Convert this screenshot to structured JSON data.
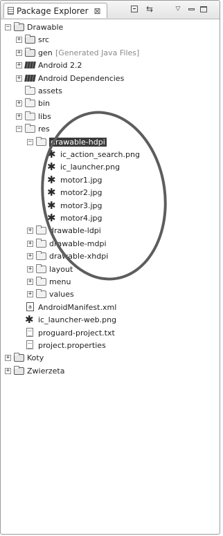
{
  "tab": {
    "title": "Package Explorer",
    "close": "⊠"
  },
  "tree": [
    {
      "label": "Drawable",
      "decor": "",
      "indent": 0,
      "expander": "−",
      "icon": "project"
    },
    {
      "label": "src",
      "decor": "",
      "indent": 1,
      "expander": "+",
      "icon": "pkgfolder"
    },
    {
      "label": "gen",
      "decor": "[Generated Java Files]",
      "indent": 1,
      "expander": "+",
      "icon": "pkgfolder"
    },
    {
      "label": "Android 2.2",
      "decor": "",
      "indent": 1,
      "expander": "+",
      "icon": "library"
    },
    {
      "label": "Android Dependencies",
      "decor": "",
      "indent": 1,
      "expander": "+",
      "icon": "library"
    },
    {
      "label": "assets",
      "decor": "",
      "indent": 1,
      "expander": "",
      "icon": "folder"
    },
    {
      "label": "bin",
      "decor": "",
      "indent": 1,
      "expander": "+",
      "icon": "folder"
    },
    {
      "label": "libs",
      "decor": "",
      "indent": 1,
      "expander": "+",
      "icon": "folder"
    },
    {
      "label": "res",
      "decor": "",
      "indent": 1,
      "expander": "−",
      "icon": "folder"
    },
    {
      "label": "drawable-hdpi",
      "decor": "",
      "indent": 2,
      "expander": "−",
      "icon": "folder",
      "selected": true
    },
    {
      "label": "ic_action_search.png",
      "decor": "",
      "indent": 3,
      "expander": "",
      "icon": "image"
    },
    {
      "label": "ic_launcher.png",
      "decor": "",
      "indent": 3,
      "expander": "",
      "icon": "image"
    },
    {
      "label": "motor1.jpg",
      "decor": "",
      "indent": 3,
      "expander": "",
      "icon": "image"
    },
    {
      "label": "motor2.jpg",
      "decor": "",
      "indent": 3,
      "expander": "",
      "icon": "image"
    },
    {
      "label": "motor3.jpg",
      "decor": "",
      "indent": 3,
      "expander": "",
      "icon": "image"
    },
    {
      "label": "motor4.jpg",
      "decor": "",
      "indent": 3,
      "expander": "",
      "icon": "image"
    },
    {
      "label": "drawable-ldpi",
      "decor": "",
      "indent": 2,
      "expander": "+",
      "icon": "folder"
    },
    {
      "label": "drawable-mdpi",
      "decor": "",
      "indent": 2,
      "expander": "+",
      "icon": "folder"
    },
    {
      "label": "drawable-xhdpi",
      "decor": "",
      "indent": 2,
      "expander": "+",
      "icon": "folder"
    },
    {
      "label": "layout",
      "decor": "",
      "indent": 2,
      "expander": "+",
      "icon": "folder"
    },
    {
      "label": "menu",
      "decor": "",
      "indent": 2,
      "expander": "+",
      "icon": "folder"
    },
    {
      "label": "values",
      "decor": "",
      "indent": 2,
      "expander": "+",
      "icon": "folder"
    },
    {
      "label": "AndroidManifest.xml",
      "decor": "",
      "indent": 1,
      "expander": "",
      "icon": "xml"
    },
    {
      "label": "ic_launcher-web.png",
      "decor": "",
      "indent": 1,
      "expander": "",
      "icon": "image"
    },
    {
      "label": "proguard-project.txt",
      "decor": "",
      "indent": 1,
      "expander": "",
      "icon": "file"
    },
    {
      "label": "project.properties",
      "decor": "",
      "indent": 1,
      "expander": "",
      "icon": "file"
    },
    {
      "label": "Koty",
      "decor": "",
      "indent": 0,
      "expander": "+",
      "icon": "project"
    },
    {
      "label": "Zwierzeta",
      "decor": "",
      "indent": 0,
      "expander": "+",
      "icon": "project"
    }
  ]
}
